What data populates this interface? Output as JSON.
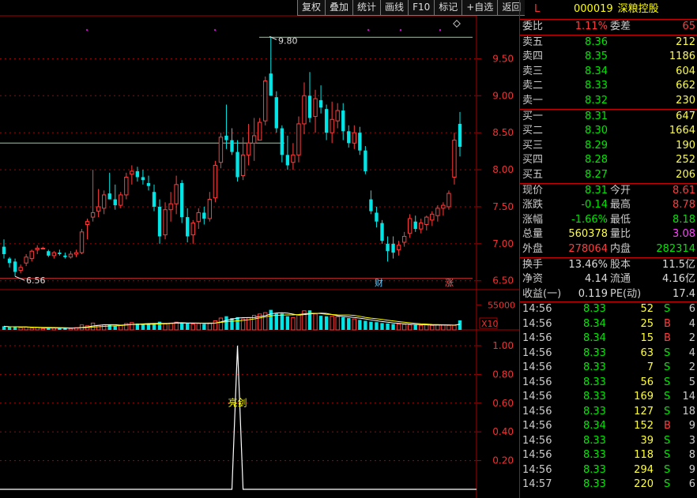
{
  "toolbar": [
    "复权",
    "叠加",
    "统计",
    "画线",
    "F10",
    "标记",
    "+自选",
    "返回"
  ],
  "quote": {
    "market": "L",
    "code": "000019",
    "name": "深粮控股",
    "weibi_label": "委比",
    "weibi": "1.11%",
    "weicha_label": "委差",
    "weicha": "65",
    "asks": [
      {
        "label": "卖五",
        "price": "8.36",
        "vol": "212"
      },
      {
        "label": "卖四",
        "price": "8.35",
        "vol": "1186"
      },
      {
        "label": "卖三",
        "price": "8.34",
        "vol": "604"
      },
      {
        "label": "卖二",
        "price": "8.33",
        "vol": "662"
      },
      {
        "label": "卖一",
        "price": "8.32",
        "vol": "230"
      }
    ],
    "bids": [
      {
        "label": "买一",
        "price": "8.31",
        "vol": "647"
      },
      {
        "label": "买二",
        "price": "8.30",
        "vol": "1664"
      },
      {
        "label": "买三",
        "price": "8.29",
        "vol": "190"
      },
      {
        "label": "买四",
        "price": "8.28",
        "vol": "252"
      },
      {
        "label": "买五",
        "price": "8.27",
        "vol": "206"
      }
    ],
    "stats": [
      {
        "l1": "现价",
        "v1": "8.31",
        "c1": "g",
        "l2": "今开",
        "v2": "8.61",
        "c2": "r"
      },
      {
        "l1": "涨跌",
        "v1": "-0.14",
        "c1": "g",
        "l2": "最高",
        "v2": "8.78",
        "c2": "r"
      },
      {
        "l1": "涨幅",
        "v1": "-1.66%",
        "c1": "g",
        "l2": "最低",
        "v2": "8.18",
        "c2": "g"
      },
      {
        "l1": "总量",
        "v1": "560378",
        "c1": "y",
        "l2": "量比",
        "v2": "3.08",
        "c2": "m"
      },
      {
        "l1": "外盘",
        "v1": "278064",
        "c1": "r",
        "l2": "内盘",
        "v2": "282314",
        "c2": "g"
      }
    ],
    "finance": [
      {
        "l1": "换手",
        "v1": "13.46%",
        "l2": "股本",
        "v2": "11.5亿"
      },
      {
        "l1": "净资",
        "v1": "4.14",
        "l2": "流通",
        "v2": "4.16亿"
      },
      {
        "l1": "收益(一)",
        "v1": "0.119",
        "l2": "PE(动)",
        "v2": "17.4"
      }
    ],
    "ticks": [
      {
        "t": "14:56",
        "p": "8.33",
        "v": "52",
        "bs": "S",
        "n": "6"
      },
      {
        "t": "14:56",
        "p": "8.34",
        "v": "25",
        "bs": "B",
        "n": "4"
      },
      {
        "t": "14:56",
        "p": "8.34",
        "v": "15",
        "bs": "B",
        "n": "2"
      },
      {
        "t": "14:56",
        "p": "8.33",
        "v": "63",
        "bs": "S",
        "n": "4"
      },
      {
        "t": "14:56",
        "p": "8.33",
        "v": "7",
        "bs": "S",
        "n": "2"
      },
      {
        "t": "14:56",
        "p": "8.33",
        "v": "56",
        "bs": "S",
        "n": "5"
      },
      {
        "t": "14:56",
        "p": "8.33",
        "v": "169",
        "bs": "S",
        "n": "14"
      },
      {
        "t": "14:56",
        "p": "8.33",
        "v": "127",
        "bs": "S",
        "n": "18"
      },
      {
        "t": "14:56",
        "p": "8.34",
        "v": "152",
        "bs": "B",
        "n": "9"
      },
      {
        "t": "14:56",
        "p": "8.33",
        "v": "39",
        "bs": "S",
        "n": "3"
      },
      {
        "t": "14:56",
        "p": "8.33",
        "v": "118",
        "bs": "S",
        "n": "8"
      },
      {
        "t": "14:56",
        "p": "8.33",
        "v": "294",
        "bs": "S",
        "n": "9"
      },
      {
        "t": "14:57",
        "p": "8.33",
        "v": "220",
        "bs": "S",
        "n": "6"
      }
    ]
  },
  "chart_data": {
    "type": "candlestick",
    "price_axis": [
      "9.50",
      "9.00",
      "8.50",
      "8.00",
      "7.50",
      "7.00",
      "6.50"
    ],
    "price_range": [
      6.38,
      10.08
    ],
    "high_label": "9.80",
    "low_label": "6.56",
    "event_labels": [
      "财",
      "涨"
    ],
    "volume_axis_label": "55000",
    "volume_unit": "X10",
    "volume_max": 7800,
    "indicator_axis": [
      "1.00",
      "0.80",
      "0.60",
      "0.40",
      "0.20"
    ],
    "indicator_label": "亮剑",
    "candles": [
      [
        6.96,
        7.06,
        6.8,
        6.86
      ],
      [
        6.8,
        6.82,
        6.68,
        6.74
      ],
      [
        6.76,
        6.8,
        6.56,
        6.62
      ],
      [
        6.64,
        6.72,
        6.6,
        6.68
      ],
      [
        6.74,
        6.86,
        6.7,
        6.82
      ],
      [
        6.8,
        6.92,
        6.76,
        6.9
      ],
      [
        6.92,
        6.98,
        6.86,
        6.94
      ],
      [
        6.94,
        6.96,
        6.94,
        6.94
      ],
      [
        6.9,
        6.92,
        6.82,
        6.84
      ],
      [
        6.84,
        6.9,
        6.8,
        6.88
      ],
      [
        6.88,
        6.92,
        6.84,
        6.86
      ],
      [
        6.84,
        6.88,
        6.8,
        6.82
      ],
      [
        6.82,
        6.9,
        6.8,
        6.86
      ],
      [
        6.86,
        6.92,
        6.82,
        6.88
      ],
      [
        6.88,
        7.2,
        6.86,
        7.16
      ],
      [
        7.26,
        7.34,
        7.06,
        7.3
      ],
      [
        7.36,
        8.0,
        7.3,
        7.42
      ],
      [
        7.44,
        7.74,
        7.36,
        7.5
      ],
      [
        7.48,
        7.72,
        7.4,
        7.66
      ],
      [
        7.68,
        7.96,
        7.6,
        7.6
      ],
      [
        7.6,
        7.8,
        7.46,
        7.52
      ],
      [
        7.52,
        7.7,
        7.48,
        7.66
      ],
      [
        7.66,
        7.96,
        7.6,
        7.9
      ],
      [
        7.94,
        8.06,
        7.8,
        7.98
      ],
      [
        7.98,
        8.04,
        7.84,
        7.9
      ],
      [
        7.9,
        8.0,
        7.8,
        7.86
      ],
      [
        7.82,
        7.92,
        7.72,
        7.78
      ],
      [
        7.7,
        7.8,
        7.44,
        7.5
      ],
      [
        7.5,
        7.6,
        7.0,
        7.1
      ],
      [
        7.12,
        7.56,
        7.06,
        7.46
      ],
      [
        7.46,
        7.7,
        7.3,
        7.54
      ],
      [
        7.54,
        7.92,
        7.4,
        7.8
      ],
      [
        7.82,
        7.86,
        7.28,
        7.36
      ],
      [
        7.36,
        7.48,
        7.02,
        7.1
      ],
      [
        7.12,
        7.32,
        7.0,
        7.28
      ],
      [
        7.3,
        7.48,
        7.2,
        7.42
      ],
      [
        7.42,
        7.5,
        7.26,
        7.34
      ],
      [
        7.34,
        7.7,
        7.3,
        7.6
      ],
      [
        7.62,
        8.12,
        7.56,
        8.06
      ],
      [
        8.1,
        8.5,
        8.02,
        8.44
      ],
      [
        8.46,
        8.88,
        8.28,
        8.4
      ],
      [
        8.4,
        8.56,
        8.2,
        8.24
      ],
      [
        8.24,
        8.4,
        7.84,
        7.9
      ],
      [
        7.92,
        8.44,
        7.86,
        8.2
      ],
      [
        8.2,
        8.62,
        8.06,
        8.36
      ],
      [
        8.36,
        8.7,
        8.12,
        8.46
      ],
      [
        8.4,
        8.7,
        8.4,
        8.64
      ],
      [
        8.66,
        9.26,
        8.6,
        9.2
      ],
      [
        9.3,
        9.8,
        9.1,
        9.0
      ],
      [
        8.98,
        9.06,
        8.5,
        8.56
      ],
      [
        8.56,
        8.6,
        8.1,
        8.2
      ],
      [
        8.2,
        8.46,
        8.0,
        8.06
      ],
      [
        8.1,
        8.36,
        8.0,
        8.2
      ],
      [
        8.2,
        8.72,
        8.1,
        8.62
      ],
      [
        8.62,
        9.18,
        8.48,
        9.0
      ],
      [
        9.0,
        9.32,
        8.64,
        8.7
      ],
      [
        8.72,
        9.08,
        8.5,
        8.96
      ],
      [
        8.94,
        9.14,
        8.76,
        8.84
      ],
      [
        8.82,
        8.88,
        8.4,
        8.5
      ],
      [
        8.5,
        8.92,
        8.36,
        8.68
      ],
      [
        8.66,
        8.9,
        8.56,
        8.8
      ],
      [
        8.8,
        8.9,
        8.4,
        8.52
      ],
      [
        8.52,
        8.6,
        8.3,
        8.36
      ],
      [
        8.36,
        8.6,
        8.28,
        8.5
      ],
      [
        8.5,
        8.58,
        8.2,
        8.26
      ],
      [
        8.26,
        8.32,
        7.94,
        7.98
      ],
      [
        7.6,
        7.72,
        7.4,
        7.44
      ],
      [
        7.42,
        7.5,
        7.22,
        7.3
      ],
      [
        7.28,
        7.32,
        7.0,
        7.04
      ],
      [
        7.0,
        7.1,
        6.76,
        6.9
      ],
      [
        7.0,
        7.1,
        6.8,
        6.88
      ],
      [
        6.92,
        7.04,
        6.84,
        6.98
      ],
      [
        7.02,
        7.16,
        6.96,
        7.1
      ],
      [
        7.14,
        7.4,
        7.08,
        7.34
      ],
      [
        7.3,
        7.38,
        7.16,
        7.2
      ],
      [
        7.2,
        7.34,
        7.14,
        7.28
      ],
      [
        7.26,
        7.38,
        7.18,
        7.36
      ],
      [
        7.32,
        7.44,
        7.24,
        7.4
      ],
      [
        7.38,
        7.52,
        7.3,
        7.48
      ],
      [
        7.48,
        7.56,
        7.38,
        7.52
      ],
      [
        7.5,
        7.72,
        7.46,
        7.68
      ],
      [
        7.9,
        8.5,
        7.8,
        8.4
      ],
      [
        8.62,
        8.78,
        8.18,
        8.31
      ]
    ],
    "volume": [
      800,
      600,
      700,
      500,
      600,
      400,
      500,
      300,
      400,
      500,
      400,
      400,
      300,
      500,
      1100,
      900,
      1500,
      1000,
      1100,
      1200,
      900,
      1000,
      1400,
      1600,
      1400,
      1200,
      1300,
      1500,
      1800,
      1300,
      1500,
      1700,
      1600,
      1500,
      1300,
      1400,
      1300,
      1500,
      2000,
      2600,
      3000,
      2600,
      2800,
      2400,
      2700,
      3200,
      3500,
      3800,
      4400,
      3600,
      3600,
      3000,
      2700,
      3300,
      4200,
      4300,
      3500,
      3100,
      3000,
      3000,
      2900,
      2800,
      2600,
      2400,
      2200,
      2000,
      1800,
      1700,
      1500,
      1400,
      1300,
      1300,
      1200,
      1100,
      1100,
      1000,
      1100,
      1000,
      1100,
      1100,
      1000,
      1000,
      2100
    ],
    "ma_levels": [
      9.79,
      8.36
    ],
    "indicator_peak_index": 42
  }
}
